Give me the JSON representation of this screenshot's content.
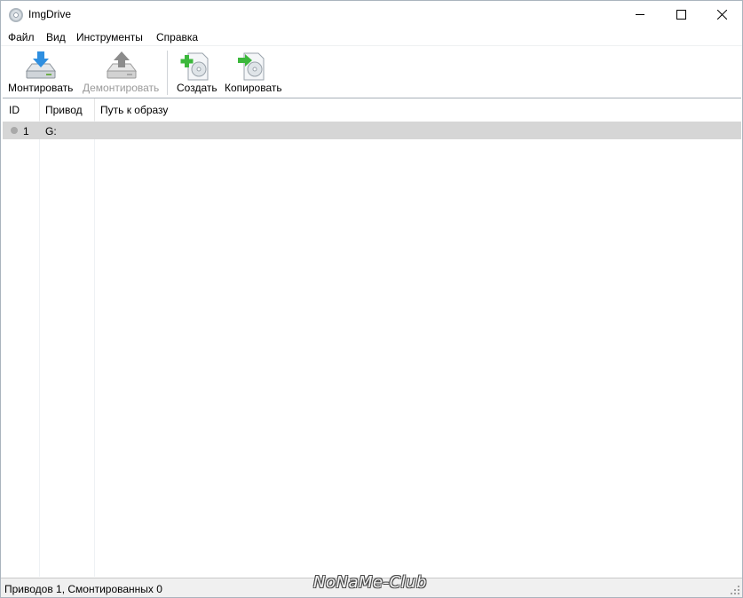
{
  "window": {
    "title": "ImgDrive"
  },
  "menu": {
    "items": [
      "Файл",
      "Вид",
      "Инструменты",
      "Справка"
    ]
  },
  "toolbar": {
    "mount_label": "Монтировать",
    "unmount_label": "Демонтировать",
    "create_label": "Создать",
    "copy_label": "Копировать"
  },
  "list": {
    "columns": [
      "ID",
      "Привод",
      "Путь к образу"
    ],
    "rows": [
      {
        "id": "1",
        "drive": "G:",
        "path": ""
      }
    ]
  },
  "status": {
    "text": "Приводов 1, Смонтированных 0"
  },
  "watermark": {
    "text": "NoNaMe-Club"
  },
  "colors": {
    "selected_row": "#d6d6d6",
    "accent_blue": "#2f8fe0",
    "accent_green": "#3cb83c",
    "disabled_text": "#9a9a9a"
  }
}
